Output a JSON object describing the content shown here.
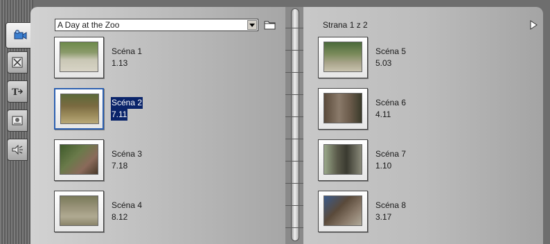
{
  "album": {
    "title": "A Day at the Zoo"
  },
  "pager": {
    "label": "Strana 1 z 2"
  },
  "tabs": [
    {
      "icon": "video-camera-icon",
      "active": true
    },
    {
      "icon": "transitions-icon",
      "active": false
    },
    {
      "icon": "title-icon",
      "active": false
    },
    {
      "icon": "photo-icon",
      "active": false
    },
    {
      "icon": "sound-effects-icon",
      "active": false
    }
  ],
  "scenes_left": [
    {
      "name": "Scéna 1",
      "duration": "1.13",
      "selected": false
    },
    {
      "name": "Scéna 2",
      "duration": "7.11",
      "selected": true
    },
    {
      "name": "Scéna 3",
      "duration": "7.18",
      "selected": false
    },
    {
      "name": "Scéna 4",
      "duration": "8.12",
      "selected": false
    }
  ],
  "scenes_right": [
    {
      "name": "Scéna 5",
      "duration": "5.03",
      "selected": false
    },
    {
      "name": "Scéna 6",
      "duration": "4.11",
      "selected": false
    },
    {
      "name": "Scéna 7",
      "duration": "1.10",
      "selected": false
    },
    {
      "name": "Scéna 8",
      "duration": "3.17",
      "selected": false
    }
  ],
  "colors": {
    "selection": "#0a246a",
    "selection_border": "#2b5fb0"
  }
}
